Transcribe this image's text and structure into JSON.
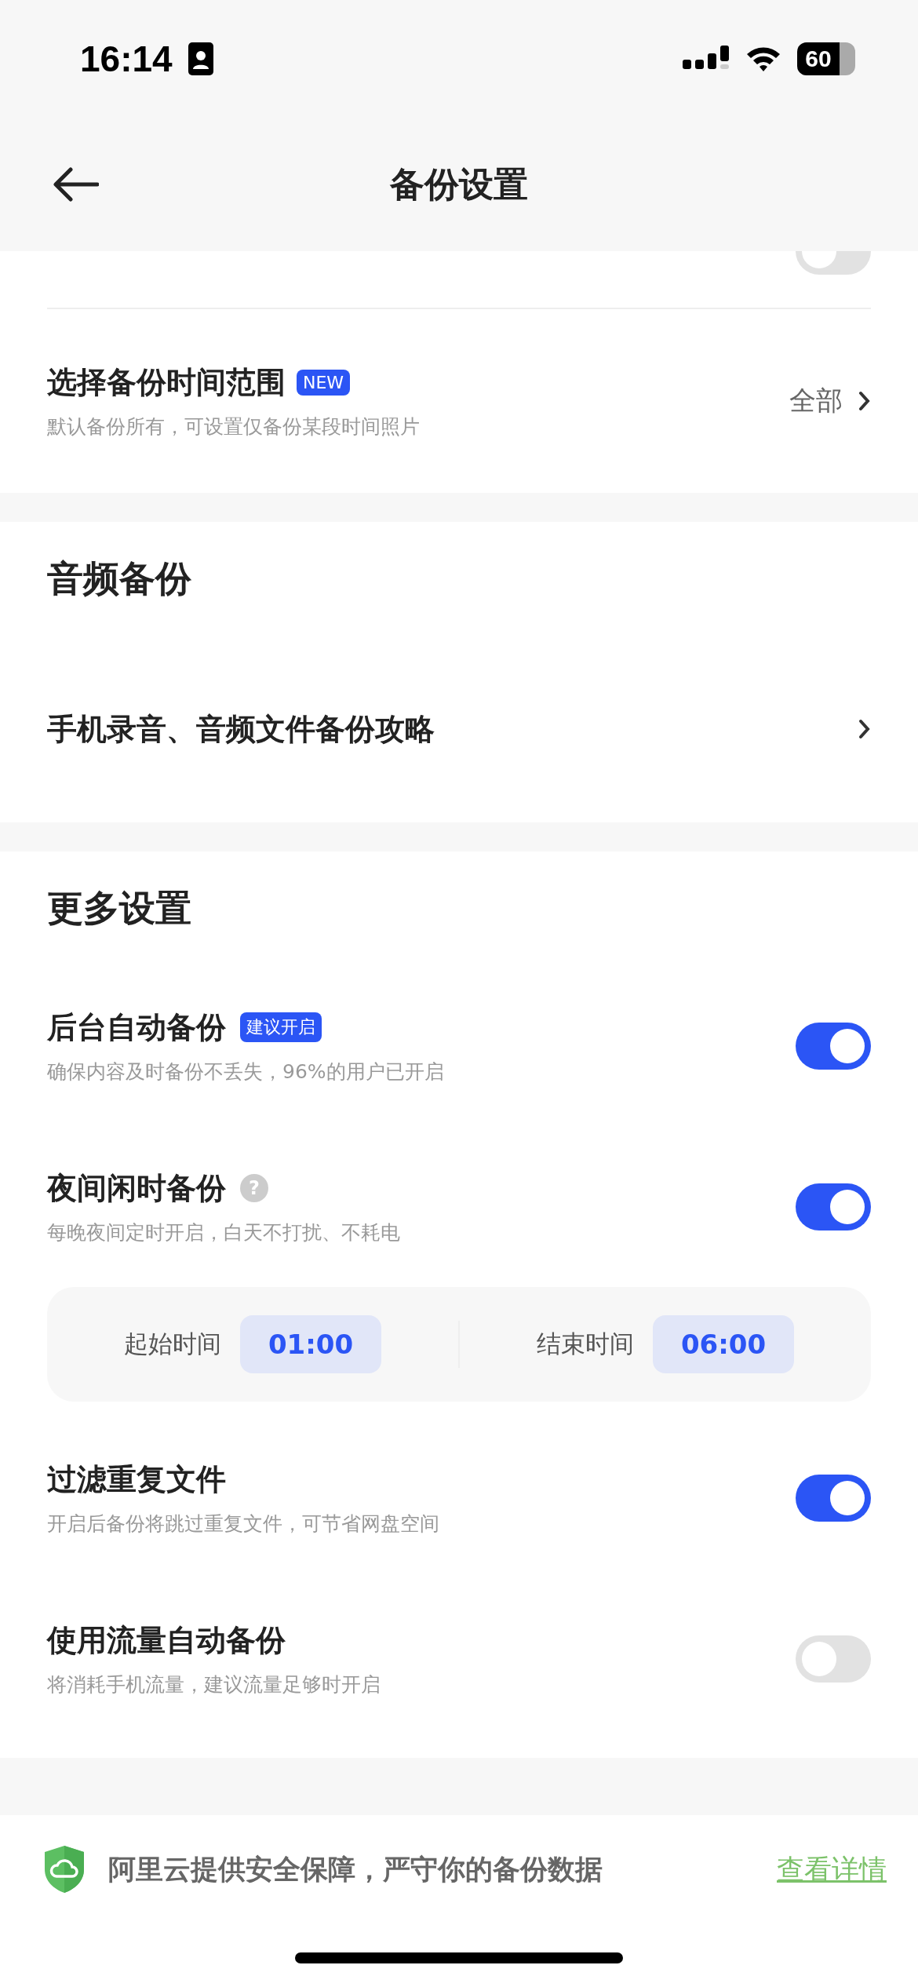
{
  "status_bar": {
    "time": "16:14",
    "battery": "60"
  },
  "header": {
    "title": "备份设置"
  },
  "cut_row": {
    "on": false
  },
  "range_row": {
    "title": "选择备份时间范围",
    "badge": "NEW",
    "subtitle": "默认备份所有，可设置仅备份某段时间照片",
    "value": "全部"
  },
  "audio_section": {
    "title": "音频备份",
    "link": "手机录音、音频文件备份攻略"
  },
  "more_section": {
    "title": "更多设置",
    "items": [
      {
        "kind": "toggle",
        "title": "后台自动备份",
        "badge": "建议开启",
        "subtitle": "确保内容及时备份不丢失，96%的用户已开启",
        "on": true
      },
      {
        "kind": "toggle",
        "title": "夜间闲时备份",
        "help": "?",
        "subtitle": "每晚夜间定时开启，白天不打扰、不耗电",
        "on": true
      },
      {
        "kind": "times",
        "start_label": "起始时间",
        "start": "01:00",
        "end_label": "结束时间",
        "end": "06:00"
      },
      {
        "kind": "toggle",
        "title": "过滤重复文件",
        "subtitle": "开启后备份将跳过重复文件，可节省网盘空间",
        "on": true
      },
      {
        "kind": "toggle",
        "title": "使用流量自动备份",
        "subtitle": "将消耗手机流量，建议流量足够时开启",
        "on": false
      }
    ]
  },
  "footer": {
    "text": "阿里云提供安全保障，严守你的备份数据",
    "link": "查看详情"
  }
}
